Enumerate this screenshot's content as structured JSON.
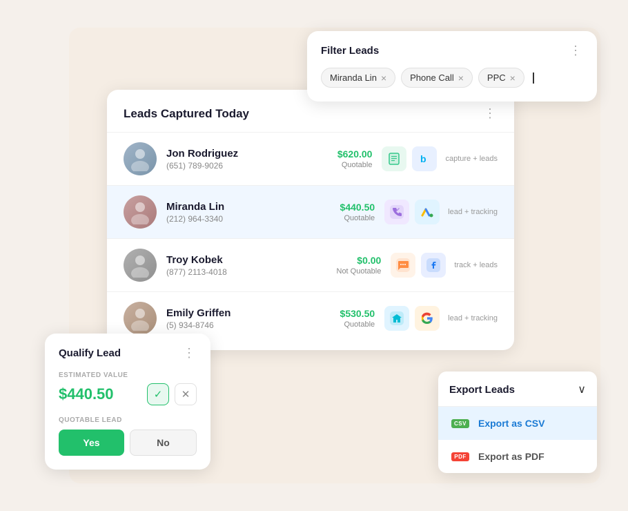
{
  "background": {
    "color": "#f5ede4"
  },
  "leads_card": {
    "title": "Leads Captured Today",
    "more_icon": "⋮",
    "leads": [
      {
        "id": "jon",
        "name": "Jon Rodriguez",
        "phone": "(651) 789-9026",
        "amount": "$620.00",
        "status": "Quotable",
        "tag": "capture + leads",
        "highlighted": false
      },
      {
        "id": "miranda",
        "name": "Miranda Lin",
        "phone": "(212) 964-3340",
        "amount": "$440.50",
        "status": "Quotable",
        "tag": "lead + tracking",
        "highlighted": true
      },
      {
        "id": "troy",
        "name": "Troy Kobek",
        "phone": "(877) 2113-4018",
        "amount": "$0.00",
        "status": "Not Quotable",
        "tag": "track + leads",
        "highlighted": false
      },
      {
        "id": "emily",
        "name": "Emily Griffen",
        "phone": "(5) 934-8746",
        "amount": "$530.50",
        "status": "Quotable",
        "tag": "lead + tracking",
        "highlighted": false
      }
    ]
  },
  "filter_card": {
    "title": "Filter Leads",
    "more_icon": "⋮",
    "chips": [
      {
        "label": "Miranda Lin"
      },
      {
        "label": "Phone Call"
      },
      {
        "label": "PPC"
      }
    ]
  },
  "qualify_card": {
    "title": "Qualify Lead",
    "more_icon": "⋮",
    "estimated_label": "ESTIMATED VALUE",
    "estimated_value": "$440.50",
    "check_icon": "✓",
    "x_icon": "✕",
    "quotable_label": "QUOTABLE LEAD",
    "yes_label": "Yes",
    "no_label": "No"
  },
  "export_card": {
    "title": "Export Leads",
    "chevron": "∨",
    "options": [
      {
        "label": "Export as CSV",
        "badge": "CSV",
        "type": "csv",
        "highlighted": true
      },
      {
        "label": "Export as PDF",
        "badge": "PDF",
        "type": "pdf",
        "highlighted": false
      }
    ]
  }
}
